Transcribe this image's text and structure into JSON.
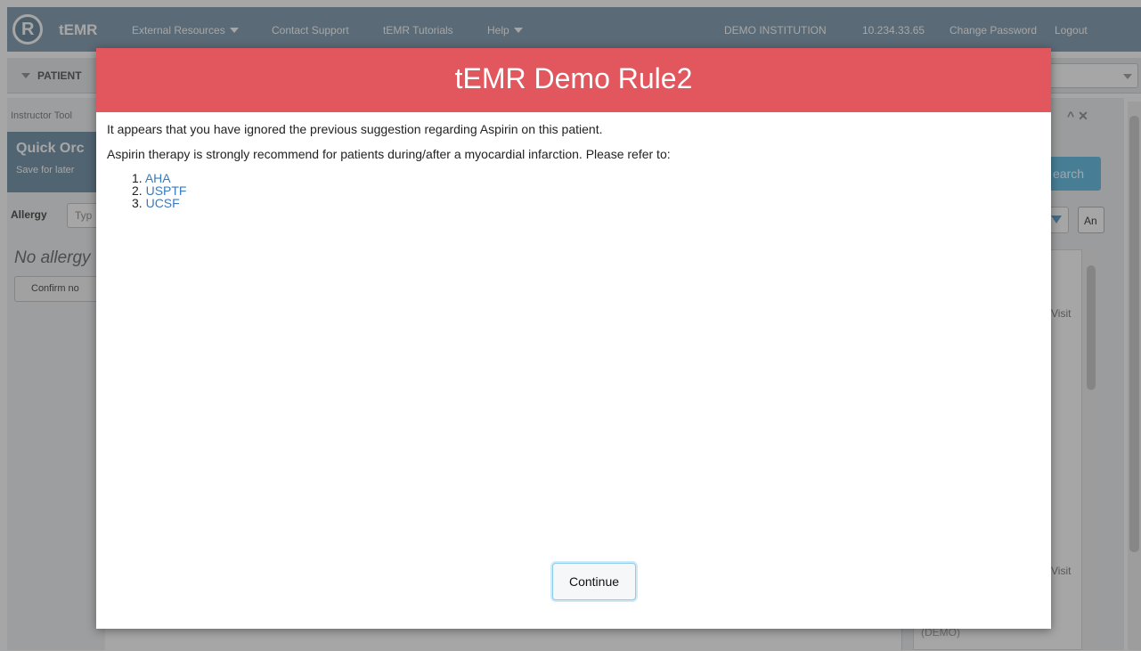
{
  "topbar": {
    "logo_glyph": "R",
    "brand": "tEMR",
    "external_resources": "External Resources",
    "contact_support": "Contact Support",
    "tutorials": "tEMR Tutorials",
    "help": "Help",
    "institution": "DEMO INSTITUTION",
    "ip": "10.234.33.65",
    "change_password": "Change Password",
    "logout": "Logout"
  },
  "background": {
    "patient_label": "PATIENT",
    "instructor_tools": "Instructor Tool",
    "quick_orders_title": "Quick Orc",
    "quick_orders_sub": "Save for later",
    "allergy_label": "Allergy",
    "allergy_placeholder": "Typ",
    "no_allergy": "No allergy",
    "confirm_no": "Confirm no",
    "panel_controls": "^ ✕",
    "search_button": "earch",
    "an_button": "An",
    "visit_1": "Visit",
    "visit_2": "Visit",
    "demo_label": "(DEMO)"
  },
  "modal": {
    "title": "tEMR Demo Rule2",
    "line1": "It appears that you have ignored the previous suggestion regarding Aspirin on this patient.",
    "line2": "Aspirin therapy is strongly recommend for patients during/after a myocardial infarction. Please refer to:",
    "references": [
      {
        "num": "1.",
        "label": "AHA"
      },
      {
        "num": "2.",
        "label": "USPTF"
      },
      {
        "num": "3.",
        "label": "UCSF"
      }
    ],
    "continue_label": "Continue"
  },
  "colors": {
    "topbar": "#8aa4b6",
    "modal_header": "#e2575e",
    "link": "#3a7bbf",
    "search_button": "#6dc2e7"
  }
}
